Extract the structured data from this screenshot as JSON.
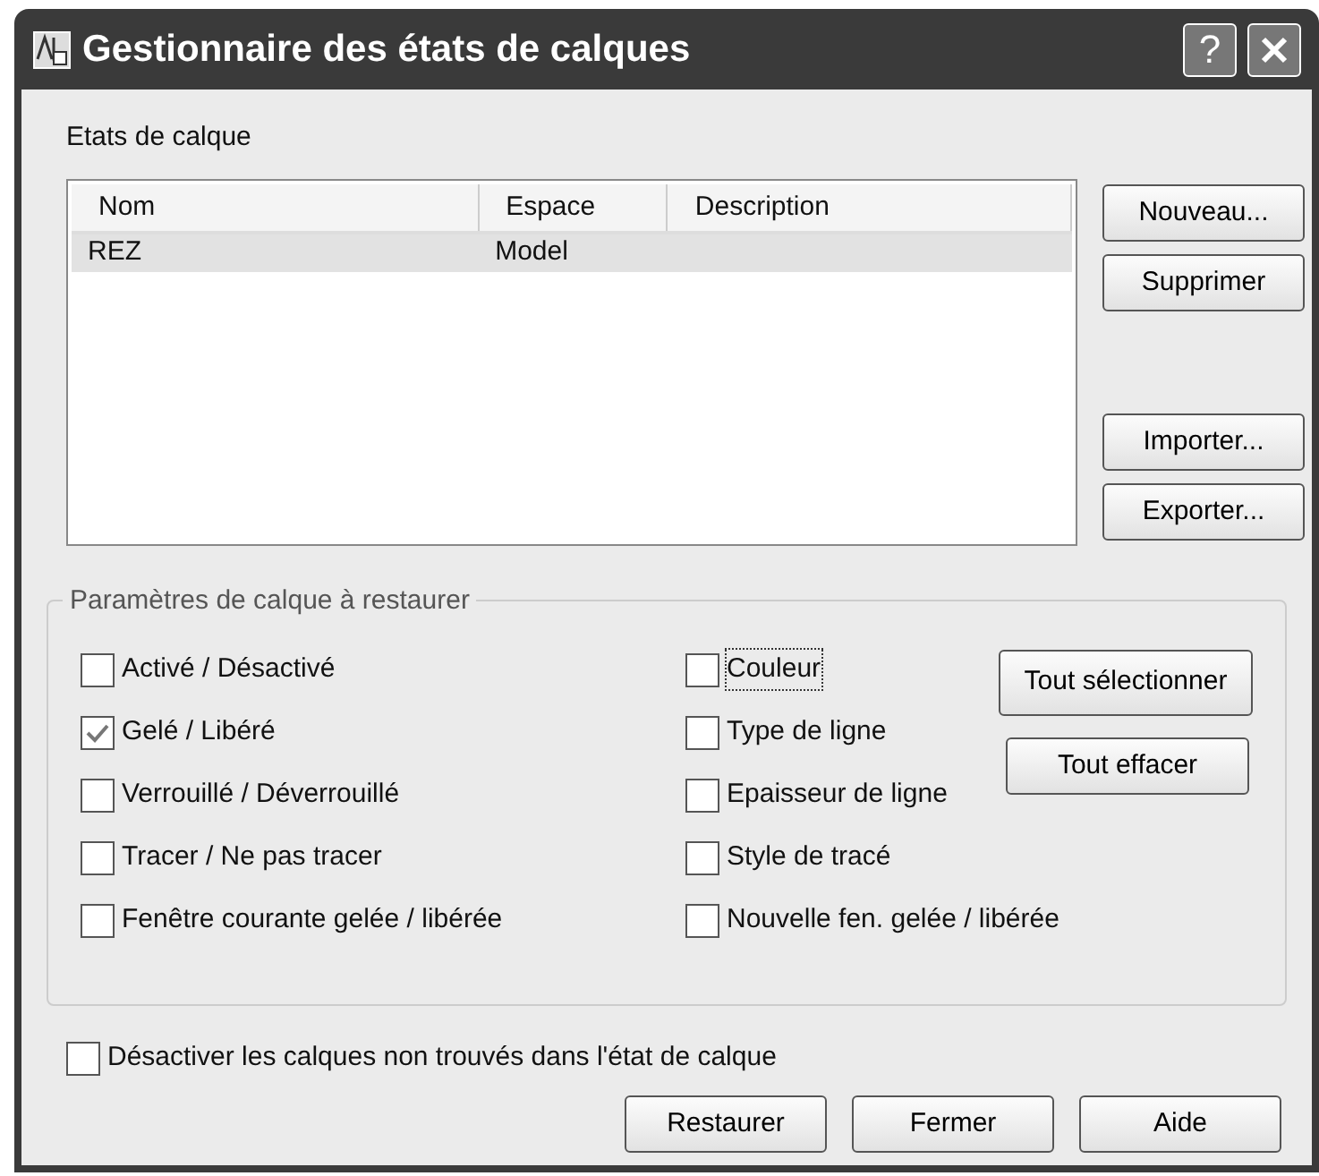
{
  "window": {
    "title": "Gestionnaire des états de calques",
    "help_button": "?"
  },
  "states_label": "Etats de calque",
  "table": {
    "columns": [
      "Nom",
      "Espace",
      "Description"
    ],
    "rows": [
      {
        "cells": [
          "REZ",
          "Model",
          ""
        ],
        "selected": true
      }
    ]
  },
  "side_buttons": [
    "Nouveau...",
    "Supprimer",
    "Importer...",
    "Exporter..."
  ],
  "group": {
    "title": "Paramètres de calque à restaurer",
    "left": [
      {
        "label": "Activé / Désactivé",
        "checked": false,
        "focused": false
      },
      {
        "label": "Gelé / Libéré",
        "checked": true,
        "focused": false
      },
      {
        "label": "Verrouillé / Déverrouillé",
        "checked": false,
        "focused": false
      },
      {
        "label": "Tracer / Ne pas tracer",
        "checked": false,
        "focused": false
      },
      {
        "label": "Fenêtre courante gelée / libérée",
        "checked": false,
        "focused": false
      }
    ],
    "right": [
      {
        "label": "Couleur",
        "checked": false,
        "focused": true
      },
      {
        "label": "Type de ligne",
        "checked": false,
        "focused": false
      },
      {
        "label": "Epaisseur de ligne",
        "checked": false,
        "focused": false
      },
      {
        "label": "Style de tracé",
        "checked": false,
        "focused": false
      },
      {
        "label": "Nouvelle fen. gelée / libérée",
        "checked": false,
        "focused": false
      }
    ],
    "buttons": [
      "Tout sélectionner",
      "Tout effacer"
    ]
  },
  "bottom_option": {
    "label": "Désactiver les calques non trouvés dans l'état de calque",
    "checked": false
  },
  "footer_buttons": [
    "Restaurer",
    "Fermer",
    "Aide"
  ]
}
